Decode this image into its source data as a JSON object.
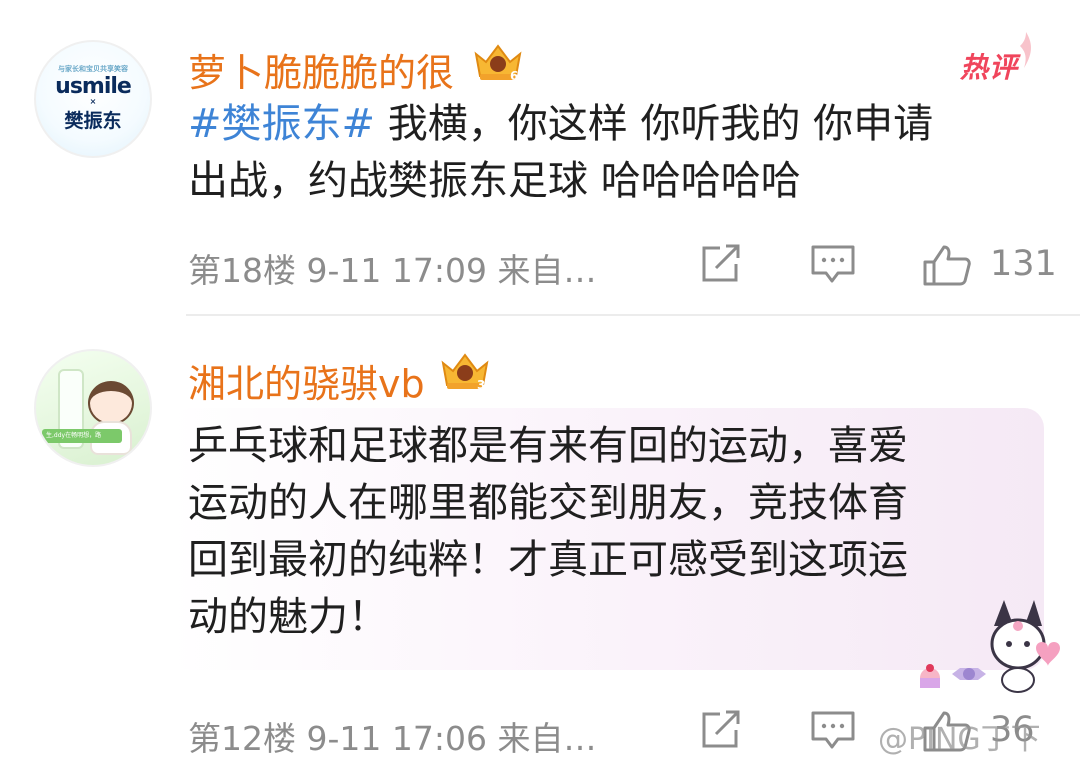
{
  "comments": [
    {
      "avatar": {
        "small_text": "与家长和宝贝共享笑容",
        "brand": "usmile",
        "x": "×",
        "name": "樊振东"
      },
      "username": "萝卜脆脆脆的很",
      "vip_level": "6",
      "hot_badge": "热评",
      "content": {
        "hashtag": "#樊振东#",
        "line1_rest": " 我横，你这样 你听我的 你申请",
        "line2": "出战，约战樊振东足球 哈哈哈哈哈"
      },
      "meta": "第18楼  9-11 17:09  来自…",
      "likes": "131"
    },
    {
      "avatar": {
        "label": "生,ddy在畅明想，路"
      },
      "username": "湘北的骁骐vb",
      "vip_level": "3",
      "content": {
        "lines": [
          "乒乓球和足球都是有来有回的运动，喜爱",
          "运动的人在哪里都能交到朋友，竞技体育",
          "回到最初的纯粹！才真正可感受到这项运",
          "动的魅力！"
        ]
      },
      "meta": "第12楼  9-11 17:06  来自…",
      "likes": "36"
    }
  ],
  "watermark": "@PING丁下",
  "colors": {
    "username": "#e8731a",
    "hashtag": "#3e84d6",
    "hot_badge": "#f0455c",
    "meta": "#8c8c8c"
  }
}
